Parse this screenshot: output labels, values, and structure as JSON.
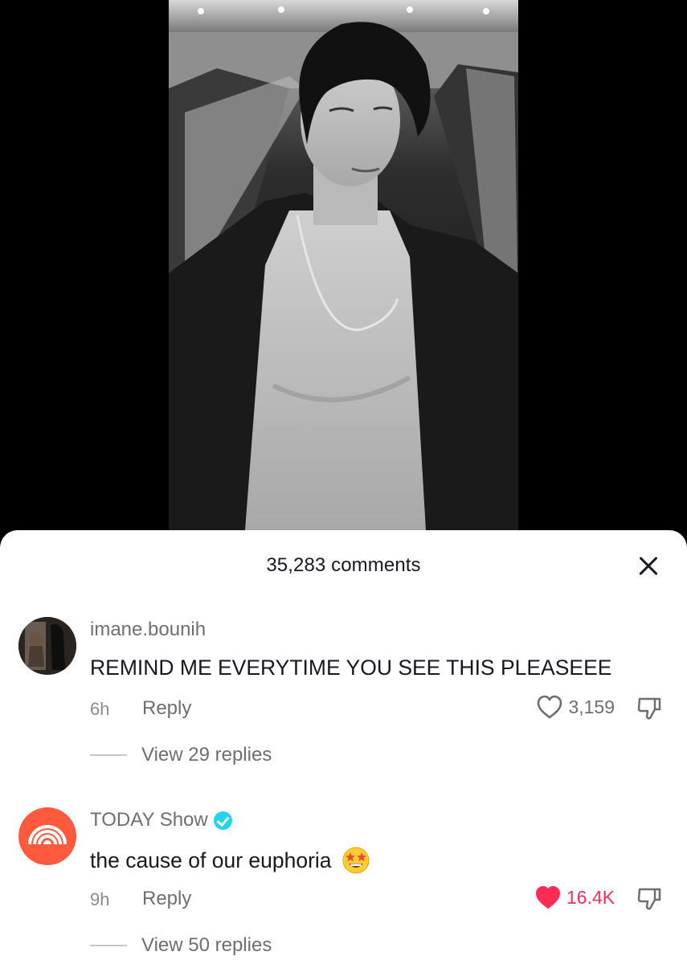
{
  "video": {
    "description_icon": "video-frame"
  },
  "comments_sheet": {
    "title": "35,283 comments",
    "close_icon": "close-icon"
  },
  "comments": [
    {
      "username": "imane.bounih",
      "verified": false,
      "text": "REMIND ME EVERYTIME YOU SEE THIS PLEASEEE",
      "time": "6h",
      "reply_label": "Reply",
      "likes": "3,159",
      "liked": false,
      "view_replies": "View 29 replies",
      "avatar_icon": "user-photo-avatar"
    },
    {
      "username": "TODAY Show",
      "verified": true,
      "text": "the cause of our euphoria",
      "emoji": "star-struck-emoji",
      "time": "9h",
      "reply_label": "Reply",
      "likes": "16.4K",
      "liked": true,
      "view_replies": "View 50 replies",
      "avatar_icon": "today-show-rainbow-logo"
    }
  ],
  "colors": {
    "liked_red": "#fe2c55",
    "verified_cyan": "#20d5ec",
    "today_orange": "#ff5a3d",
    "text_primary": "#161823",
    "text_secondary": "#6e6e73"
  }
}
